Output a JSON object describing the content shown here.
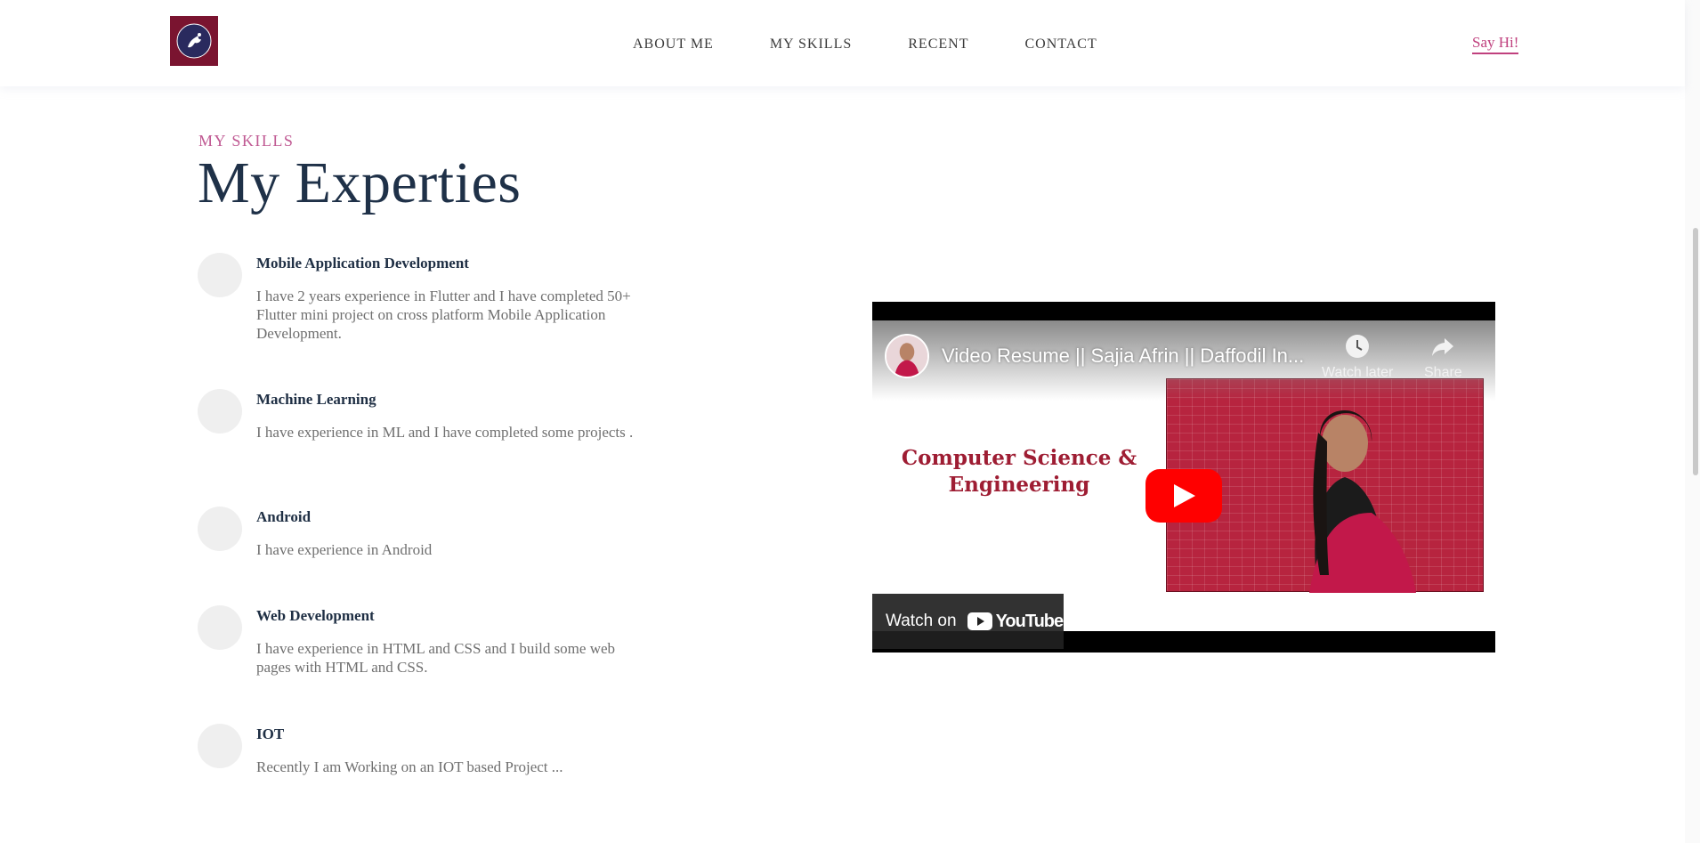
{
  "nav": {
    "items": [
      "ABOUT ME",
      "MY SKILLS",
      "RECENT",
      "CONTACT"
    ],
    "cta": "Say Hi!"
  },
  "section": {
    "eyebrow": "MY SKILLS",
    "title": "My Experties"
  },
  "skills": [
    {
      "title": "Mobile Application Development",
      "desc": "I have 2 years experience in Flutter and I have completed 50+ Flutter mini project on cross platform Mobile Application Development."
    },
    {
      "title": "Machine Learning",
      "desc": "I have experience in ML and I have completed some projects ."
    },
    {
      "title": "Android",
      "desc": "I have experience in Android"
    },
    {
      "title": "Web Development",
      "desc": "I have experience in HTML and CSS and I build some web pages with HTML and CSS."
    },
    {
      "title": "IOT",
      "desc": "Recently I am Working on an IOT based Project ..."
    }
  ],
  "video": {
    "title": "Video Resume || Sajia Afrin || Daffodil In...",
    "watch_later": "Watch later",
    "share": "Share",
    "thumbnail_text": "Computer Science & Engineering",
    "watch_on": "Watch on",
    "youtube": "YouTube"
  },
  "colors": {
    "accent": "#c0407e",
    "heading": "#1f3148",
    "logo_bg": "#7a1430"
  }
}
